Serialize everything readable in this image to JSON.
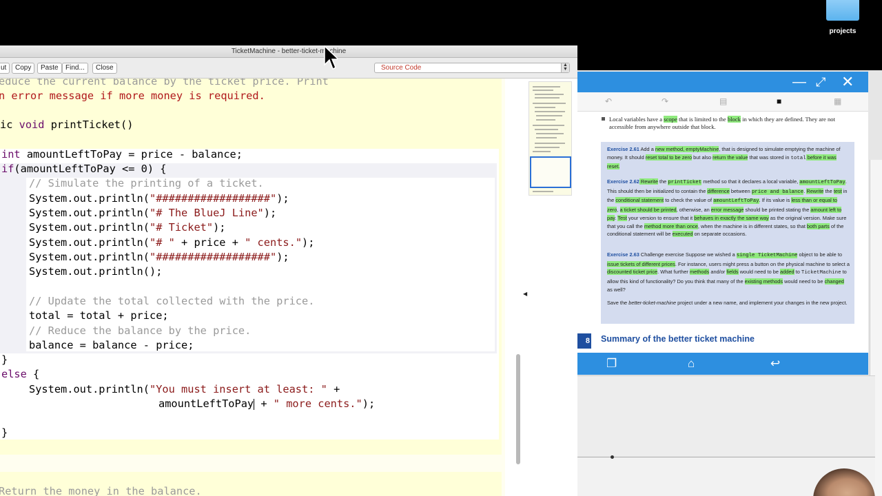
{
  "desktop": {
    "folder_label": "projects"
  },
  "editor": {
    "title": "TicketMachine - better-ticket-machine",
    "toolbar": {
      "cut_label": "ut",
      "copy_label": "Copy",
      "paste_label": "Paste",
      "find_label": "Find...",
      "close_label": "Close"
    },
    "view_select": "Source Code",
    "code": {
      "l1": "educe the current balance by the ticket price. Print",
      "l2": "n error message if more money is required.",
      "l3a": "ic ",
      "l3b": "void",
      "l3c": " printTicket()",
      "l4a": "int",
      "l4b": " amountLeftToPay = price - balance;",
      "l5a": "if",
      "l5b": "(amountLeftToPay <= 0) {",
      "l6": "// Simulate the printing of a ticket.",
      "l7a": "System.out.println(",
      "l7b": "\"##################\"",
      "l7c": ");",
      "l8a": "System.out.println(",
      "l8b": "\"# The BlueJ Line\"",
      "l8c": ");",
      "l9a": "System.out.println(",
      "l9b": "\"# Ticket\"",
      "l9c": ");",
      "l10a": "System.out.println(",
      "l10b": "\"# \"",
      "l10c": " + price + ",
      "l10d": "\" cents.\"",
      "l10e": ");",
      "l11a": "System.out.println(",
      "l11b": "\"##################\"",
      "l11c": ");",
      "l12": "System.out.println();",
      "l13": "// Update the total collected with the price.",
      "l14": "total = total + price;",
      "l15": "// Reduce the balance by the price.",
      "l16": "balance = balance - price;",
      "l17": "}",
      "l18a": "else",
      "l18b": " {",
      "l19a": "System.out.println(",
      "l19b": "\"You must insert at least: \"",
      "l19c": " +",
      "l20a": "amountLeftToPay",
      "l20b": " + ",
      "l20c": "\" more cents.\"",
      "l20d": ");",
      "l21": "}",
      "l22": "Return the money in the balance."
    }
  },
  "viewer": {
    "bullet": {
      "t1": "Local variables have a ",
      "h1": "scope",
      "t2": " that is limited to the ",
      "h2": "block",
      "t3": " in which they are defined. They are not accessible from anywhere outside that block."
    },
    "ex261": {
      "head": "Exercise 2.61",
      "t1": " Add a ",
      "h1": "new method, emptyMachine",
      "t2": ", that is designed to simulate emptying the machine of money. It should ",
      "h2": "reset total to be zero",
      "t3": " but also ",
      "h3": "return the value",
      "t4": " that was stored in ",
      "m1": "total",
      "h4": " before it was reset."
    },
    "ex262": {
      "head": "Exercise 2.62",
      "h1": " Rewrite",
      "t1": " the ",
      "h2": "printTicket",
      "t2": " method so that it declares a local variable, ",
      "h3": "amountLeftToPay",
      "t3": ". This should then be initialized to contain the ",
      "h4": "difference",
      "t4": " between ",
      "h5": "price and balance",
      "t5": ". ",
      "h6": "Rewrite",
      "t6": " the ",
      "h7": "test",
      "t7": " in the ",
      "h8": "conditional statement",
      "t8": " to check the value of ",
      "h9": "amountLeftToPay",
      "t9": ". If its value is ",
      "h10": "less than or equal to zero",
      "t10": ", ",
      "h11": "a ticket should be printed",
      "t11": ", otherwise, an ",
      "h12": "error message",
      "t12": " should be printed stating the ",
      "h13": "amount left to pay",
      "t13": ". ",
      "h14": "Test",
      "t14": " your version to ensure that it ",
      "h15": "behaves in exactly the same way",
      "t15": " as the original version. Make sure that you call the ",
      "h16": "method more than once",
      "t16": ", when the machine is in different states, so that ",
      "h17": "both parts",
      "t17": " of the conditional statement will be ",
      "h18": "executed",
      "t18": " on separate occasions."
    },
    "ex263": {
      "head": "Exercise 2.63",
      "t1": " Challenge exercise Suppose we wished a ",
      "h1": "single TicketMachine",
      "t2": " object to be able to ",
      "h2": "issue tickets of different prices",
      "t3": ". For instance, users might press a button on the physical machine to select a ",
      "h3": "discounted ticket price",
      "t4": ". What further ",
      "h4": "methods",
      "t5": " and/or ",
      "h5": "fields",
      "t6": " would need to be ",
      "h6": "added",
      "t7": " to ",
      "m1": "TicketMachine",
      "t8": " to allow this kind of functionality? Do you think that many of the ",
      "h7": "existing methods",
      "t9": " would need to be ",
      "h8": "changed",
      "t10": " as well?"
    },
    "save_note": {
      "t1": "Save the ",
      "i1": "better-ticket-machine",
      "t2": " project under a new name, and implement your changes in the new project."
    },
    "section_number": "8",
    "section_title": "Summary of the better ticket machine"
  }
}
